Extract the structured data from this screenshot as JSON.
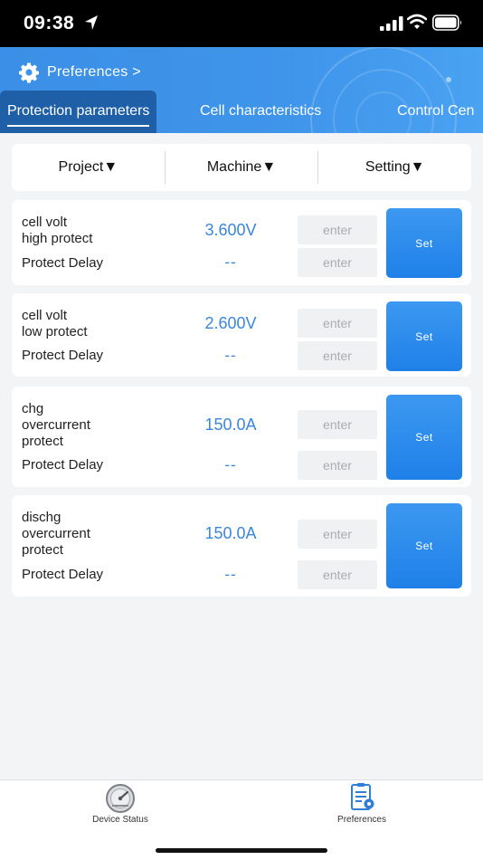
{
  "status_bar": {
    "time": "09:38"
  },
  "header": {
    "breadcrumb": "Preferences >",
    "tabs": [
      {
        "label": "Protection parameters",
        "active": true
      },
      {
        "label": "Cell characteristics",
        "active": false
      },
      {
        "label": "Control Cen",
        "active": false
      }
    ]
  },
  "filters": {
    "project": "Project▼",
    "machine": "Machine▼",
    "setting": "Setting▼"
  },
  "params": [
    {
      "label": "cell volt\nhigh protect",
      "value": "3.600V",
      "delay_label": "Protect Delay",
      "delay_value": "--",
      "placeholder": "enter",
      "button": "Set"
    },
    {
      "label": "cell volt\nlow protect",
      "value": "2.600V",
      "delay_label": "Protect Delay",
      "delay_value": "--",
      "placeholder": "enter",
      "button": "Set"
    },
    {
      "label": "chg\novercurrent\nprotect",
      "value": "150.0A",
      "delay_label": "Protect Delay",
      "delay_value": "--",
      "placeholder": "enter",
      "button": "Set"
    },
    {
      "label": "dischg\novercurrent\nprotect",
      "value": "150.0A",
      "delay_label": "Protect Delay",
      "delay_value": "--",
      "placeholder": "enter",
      "button": "Set"
    }
  ],
  "bottom_nav": [
    {
      "label": "Device Status",
      "icon": "gauge-icon"
    },
    {
      "label": "Preferences",
      "icon": "document-gear-icon"
    }
  ],
  "colors": {
    "header": "#3f95ea",
    "accent": "#1f80e8",
    "value": "#3b86d9",
    "active_tab": "#1e5fa8"
  }
}
